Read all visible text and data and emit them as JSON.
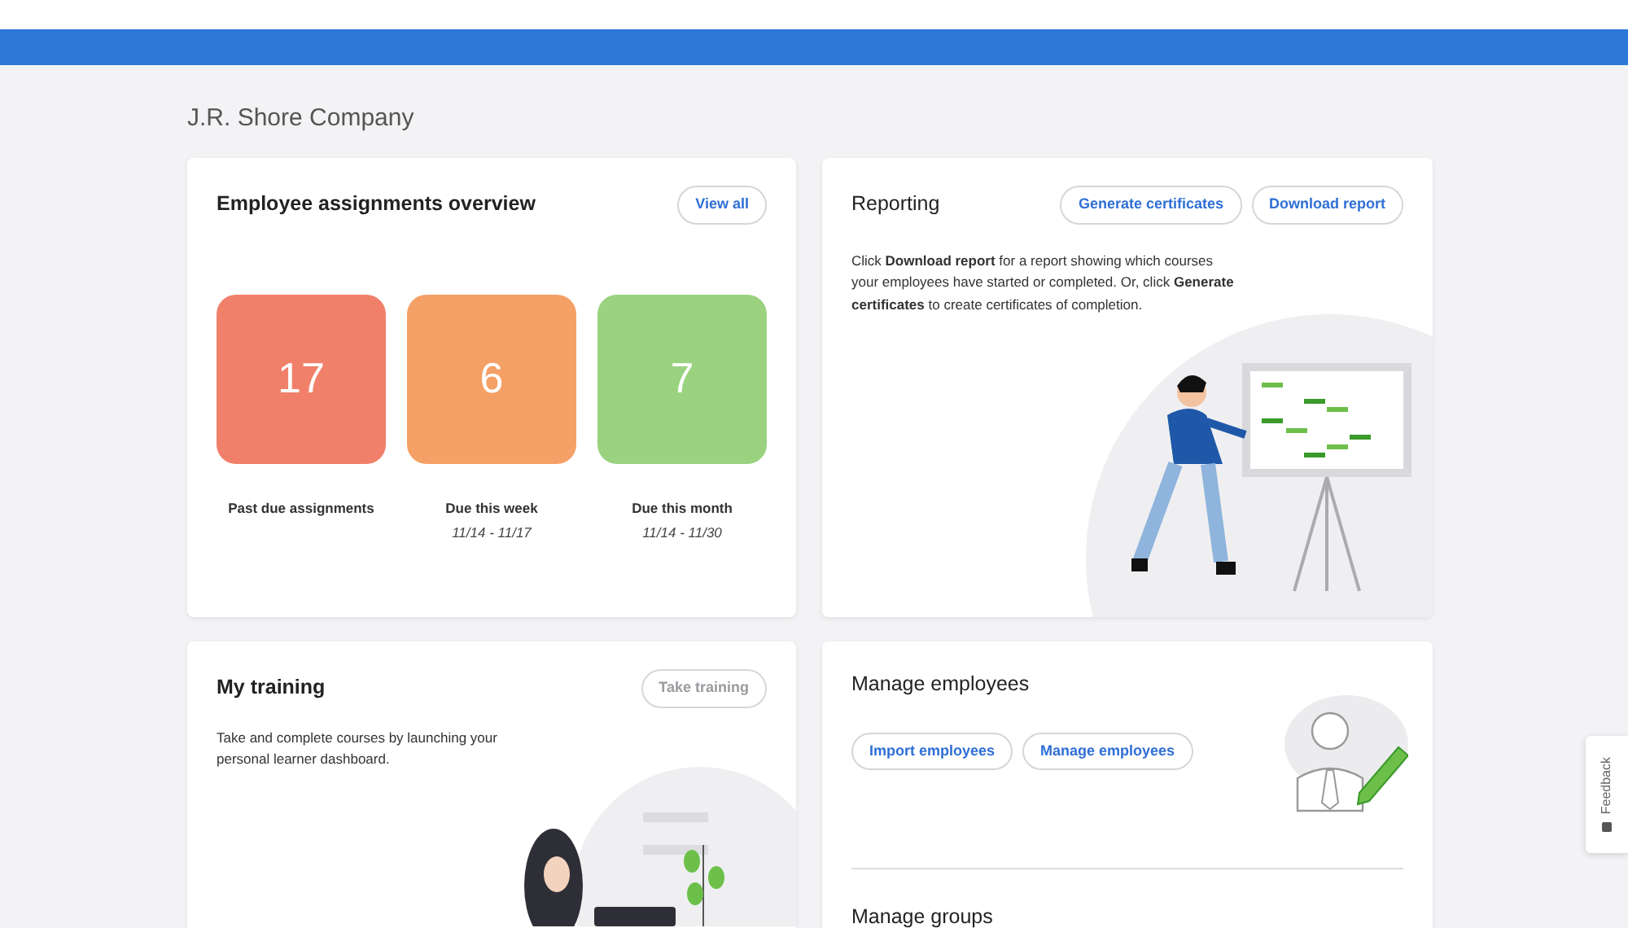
{
  "company": "J.R. Shore Company",
  "assignments": {
    "title": "Employee assignments overview",
    "button": "View all",
    "tiles": [
      {
        "count": "17",
        "label": "Past due assignments",
        "color": "#f0806a"
      },
      {
        "count": "6",
        "label": "Due this week",
        "dates": "11/14 - 11/17",
        "color": "#f5a066"
      },
      {
        "count": "7",
        "label": "Due this month",
        "dates": "11/14 - 11/30",
        "color": "#9ad27f"
      }
    ]
  },
  "reporting": {
    "title": "Reporting",
    "buttons": [
      "Generate certificates",
      "Download report"
    ],
    "text": "Click **Download report** for a report showing which courses your employees have started or completed. Or, click **Generate certificates** to create certificates of completion."
  },
  "training": {
    "title": "My training",
    "button": {
      "label": "Take training",
      "disabled": true
    },
    "text": "Take and complete courses by launching your personal learner dashboard."
  },
  "employees": {
    "title": "Manage employees",
    "buttons": [
      "Import employees",
      "Manage employees"
    ],
    "next_title": "Manage groups"
  },
  "feedback": "Feedback"
}
